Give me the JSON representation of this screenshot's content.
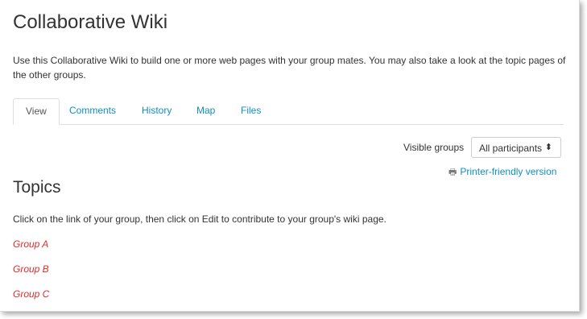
{
  "page": {
    "title": "Collaborative Wiki",
    "intro": "Use this Collaborative Wiki to build one or more web pages with your group mates. You may also take a look at the topic pages of the other groups."
  },
  "tabs": [
    {
      "label": "View",
      "active": true
    },
    {
      "label": "Comments",
      "active": false
    },
    {
      "label": "History",
      "active": false
    },
    {
      "label": "Map",
      "active": false
    },
    {
      "label": "Files",
      "active": false
    }
  ],
  "visible_groups": {
    "label": "Visible groups",
    "selected": "All participants"
  },
  "printer_link": {
    "label": "Printer-friendly version",
    "icon": "printer-icon"
  },
  "content": {
    "heading": "Topics",
    "instructions": "Click on the link of your group, then click on Edit to contribute to your group's wiki page.",
    "groups": [
      "Group A",
      "Group B",
      "Group C"
    ]
  },
  "colors": {
    "link": "#0f8fc4",
    "group_link": "#e02b2b"
  }
}
